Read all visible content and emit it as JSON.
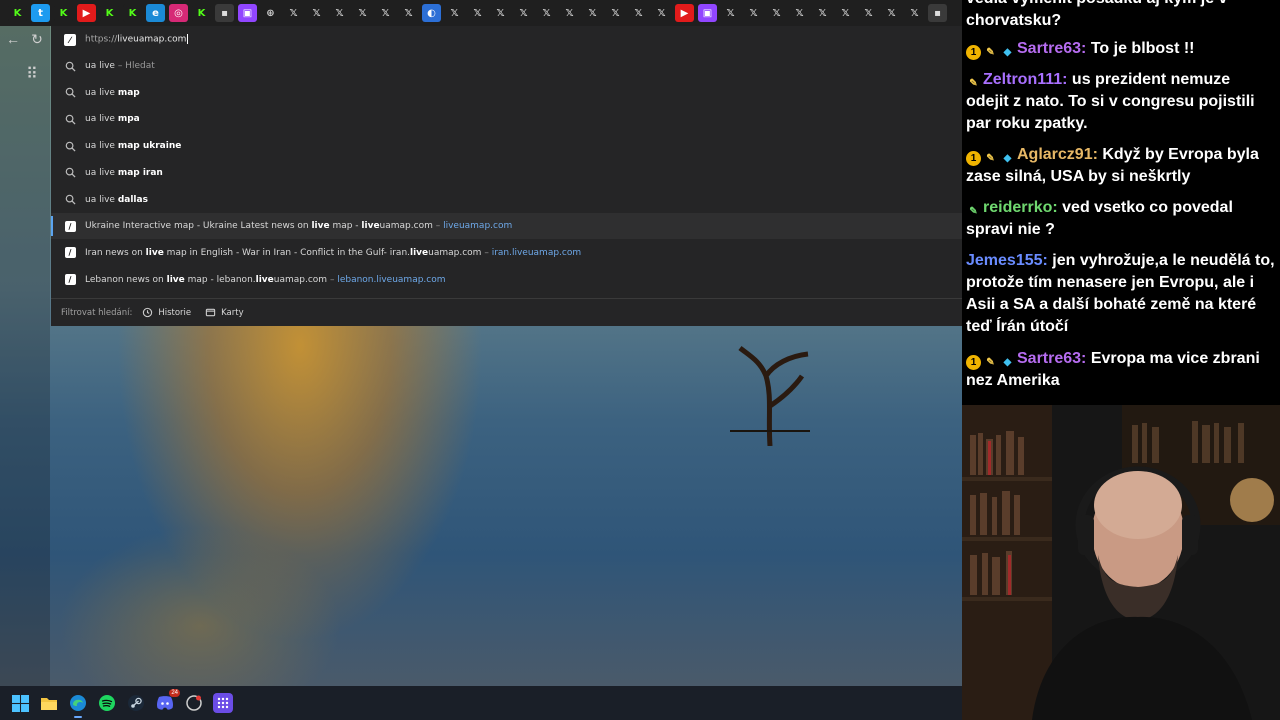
{
  "tabs": {
    "favicons": [
      "k-icon",
      "twitter-icon",
      "k-icon",
      "youtube-icon",
      "k-icon",
      "kick-icon",
      "edge-icon",
      "instagram-icon",
      "k-icon",
      "generic-icon",
      "twitch-icon",
      "globe-icon",
      "x-icon",
      "x-icon",
      "x-icon",
      "x-icon",
      "x-icon",
      "x-icon",
      "news-icon",
      "x-icon",
      "x-icon",
      "x-icon",
      "x-icon",
      "x-icon",
      "x-icon",
      "x-icon",
      "x-icon",
      "x-icon",
      "x-icon",
      "youtube-icon",
      "twitch-icon",
      "x-icon",
      "x-icon",
      "x-icon",
      "x-icon",
      "x-icon",
      "x-icon",
      "x-icon",
      "x-icon",
      "x-icon",
      "generic-icon"
    ]
  },
  "omnibox": {
    "url_prefix": "https://",
    "url_typed": "liveuamap.com",
    "suggestions": [
      {
        "type": "search",
        "bold_prefix": "",
        "text": "ua live",
        "bold": "",
        "hint": "– Hledat"
      },
      {
        "type": "search",
        "text": "ua live ",
        "bold": "map",
        "hint": ""
      },
      {
        "type": "search",
        "text": "ua live ",
        "bold": "mpa",
        "hint": ""
      },
      {
        "type": "search",
        "text": "ua live ",
        "bold": "map ukraine",
        "hint": ""
      },
      {
        "type": "search",
        "text": "ua live ",
        "bold": "map iran",
        "hint": ""
      },
      {
        "type": "search",
        "text": "ua live ",
        "bold": "dallas",
        "hint": ""
      }
    ],
    "sites": [
      {
        "pre": "Ukraine Interactive map - Ukraine Latest news on ",
        "b1": "live",
        "mid": " map - ",
        "b2": "live",
        "post": "uamap.com",
        "link": "liveuamap.com",
        "link_bold_end": 9
      },
      {
        "pre": "Iran news on ",
        "b1": "live",
        "mid": " map in English - War in Iran - Conflict in the Gulf- iran.",
        "b2": "live",
        "post": "uamap.com",
        "link": "iran.liveuamap.com"
      },
      {
        "pre": "Lebanon news on ",
        "b1": "live",
        "mid": " map - lebanon.",
        "b2": "live",
        "post": "uamap.com",
        "link": "lebanon.liveuamap.com"
      }
    ],
    "filter_label": "Filtrovat hledání:",
    "filter_history": "Historie",
    "filter_tabs": "Karty"
  },
  "taskbar": {
    "items": [
      "windows-start-icon",
      "file-explorer-icon",
      "edge-icon",
      "spotify-icon",
      "steam-icon",
      "discord-icon",
      "app-icon",
      "app-grid-icon"
    ],
    "discord_badge": "24"
  },
  "chat": {
    "top_partial": "vedia vymenit posadku aj kym je v chorvatsku?",
    "messages": [
      {
        "user": "Sartre63:",
        "color": "#b66cf0",
        "badges": [
          "one",
          "tip",
          "cube"
        ],
        "text": "To je blbost !!"
      },
      {
        "user": "Zeltron111:",
        "color": "#a970ff",
        "badges": [
          "tip"
        ],
        "text": "us prezident nemuze odejit z nato. To si v congresu pojistili par roku zpatky."
      },
      {
        "user": "Aglarcz91:",
        "color": "#e7b866",
        "badges": [
          "one",
          "tip",
          "cube"
        ],
        "text": "Když by Evropa byla zase silná, USA by si neškrtly"
      },
      {
        "user": "reiderrko:",
        "color": "#6fd86f",
        "badges": [
          "tipgreen"
        ],
        "text": "ved vsetko co povedal spravi nie ?"
      },
      {
        "user": "Jemes155:",
        "color": "#6a8cff",
        "badges": [],
        "text": "jen vyhrožuje,a le neudělá to, protože tím nenasere jen Evropu, ale i Asii a SA a další bohaté země na které teď Írán útočí"
      },
      {
        "user": "Sartre63:",
        "color": "#b66cf0",
        "badges": [
          "one",
          "tip",
          "cube"
        ],
        "text": "Evropa ma vice zbrani nez Amerika"
      }
    ]
  }
}
